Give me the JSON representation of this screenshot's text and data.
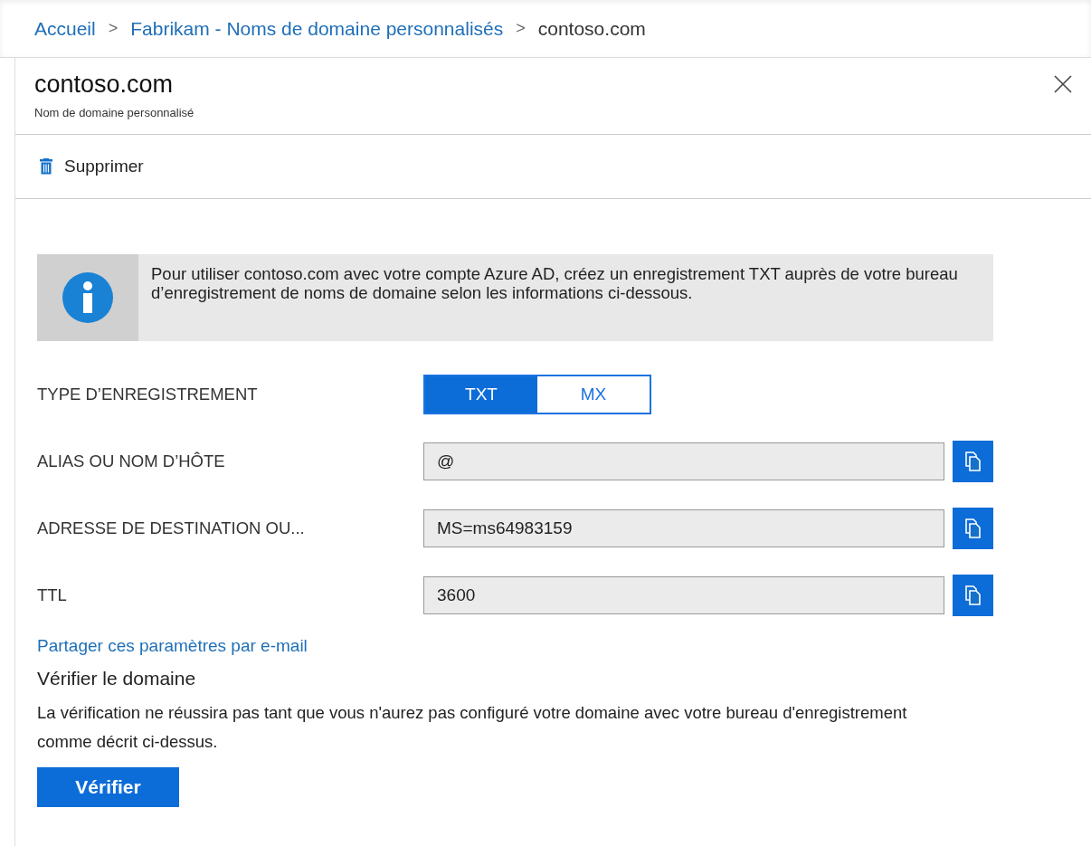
{
  "breadcrumb": [
    {
      "label": "Accueil",
      "link": true
    },
    {
      "label": "Fabrikam - Noms de domaine personnalisés",
      "link": true
    },
    {
      "label": "contoso.com",
      "link": false
    }
  ],
  "separator": ">",
  "blade": {
    "title": "contoso.com",
    "subtitle": "Nom de domaine personnalisé"
  },
  "toolbar": [
    {
      "label": "Supprimer"
    }
  ],
  "info": {
    "text": "Pour utiliser contoso.com avec votre compte Azure AD, créez un enregistrement TXT auprès de votre bureau d’enregistrement de noms de domaine selon les informations ci-dessous."
  },
  "record_type": {
    "label": "TYPE D’ENREGISTREMENT",
    "options": [
      {
        "label": "TXT",
        "selected": true
      },
      {
        "label": "MX",
        "selected": false
      }
    ]
  },
  "fields": [
    {
      "label": "ALIAS OU NOM D’HÔTE",
      "value": "@"
    },
    {
      "label": "ADRESSE DE DESTINATION OU...",
      "value": "MS=ms64983159"
    },
    {
      "label": "TTL",
      "value": "3600"
    }
  ],
  "share_link": "Partager ces paramètres par e-mail",
  "verify": {
    "heading": "Vérifier le domaine",
    "text": "La vérification ne réussira pas tant que vous n'aurez pas configuré votre domaine avec votre bureau d'enregistrement comme décrit ci-dessus.",
    "button": "Vérifier"
  }
}
